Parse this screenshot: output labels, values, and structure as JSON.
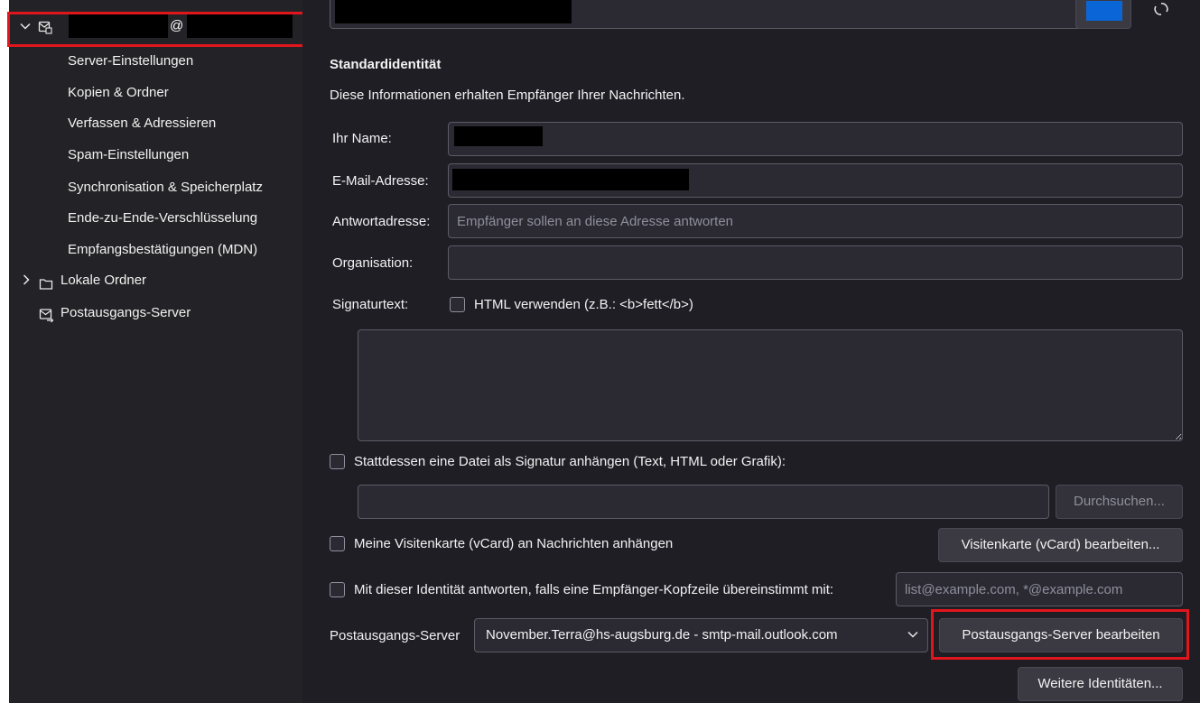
{
  "sidebar": {
    "account": {
      "email_at": "@",
      "expand_icon": "chevron-down-icon",
      "icon": "mail-account-icon"
    },
    "items": [
      {
        "label": "Server-Einstellungen"
      },
      {
        "label": "Kopien & Ordner"
      },
      {
        "label": "Verfassen & Adressieren"
      },
      {
        "label": "Spam-Einstellungen"
      },
      {
        "label": "Synchronisation & Speicherplatz"
      },
      {
        "label": "Ende-zu-Ende-Verschlüsselung"
      },
      {
        "label": "Empfangsbestätigungen (MDN)"
      }
    ],
    "local_folders": {
      "label": "Lokale Ordner",
      "icon": "folder-icon",
      "expand_icon": "chevron-right-icon"
    },
    "outgoing_server": {
      "label": "Postausgangs-Server",
      "icon": "outgoing-server-icon"
    }
  },
  "main": {
    "section_title": "Standardidentität",
    "section_desc": "Diese Informationen erhalten Empfänger Ihrer Nachrichten.",
    "name_label": "Ihr Name:",
    "email_label": "E-Mail-Adresse:",
    "reply_label": "Antwortadresse:",
    "reply_placeholder": "Empfänger sollen an diese Adresse antworten",
    "org_label": "Organisation:",
    "signature_label": "Signaturtext:",
    "html_checkbox_label": "HTML verwenden (z.B.: <b>fett</b>)",
    "attach_sig_label": "Stattdessen eine Datei als Signatur anhängen (Text, HTML oder Grafik):",
    "browse_button": "Durchsuchen...",
    "vcard_label": "Meine Visitenkarte (vCard) an Nachrichten anhängen",
    "vcard_button": "Visitenkarte (vCard) bearbeiten...",
    "reply_identity_label": "Mit dieser Identität antworten, falls eine Empfänger-Kopfzeile übereinstimmt mit:",
    "reply_identity_placeholder": "list@example.com, *@example.com",
    "smtp_label": "Postausgangs-Server",
    "smtp_value": "November.Terra@hs-augsburg.de - smtp-mail.outlook.com",
    "smtp_button": "Postausgangs-Server bearbeiten",
    "more_identities_button": "Weitere Identitäten...",
    "sync_icon": "refresh-icon",
    "color_swatch": "#0a66d6"
  },
  "colors": {
    "sidebar_bg": "#232327",
    "main_bg": "#1f1e25",
    "highlight": "#e0161c"
  }
}
